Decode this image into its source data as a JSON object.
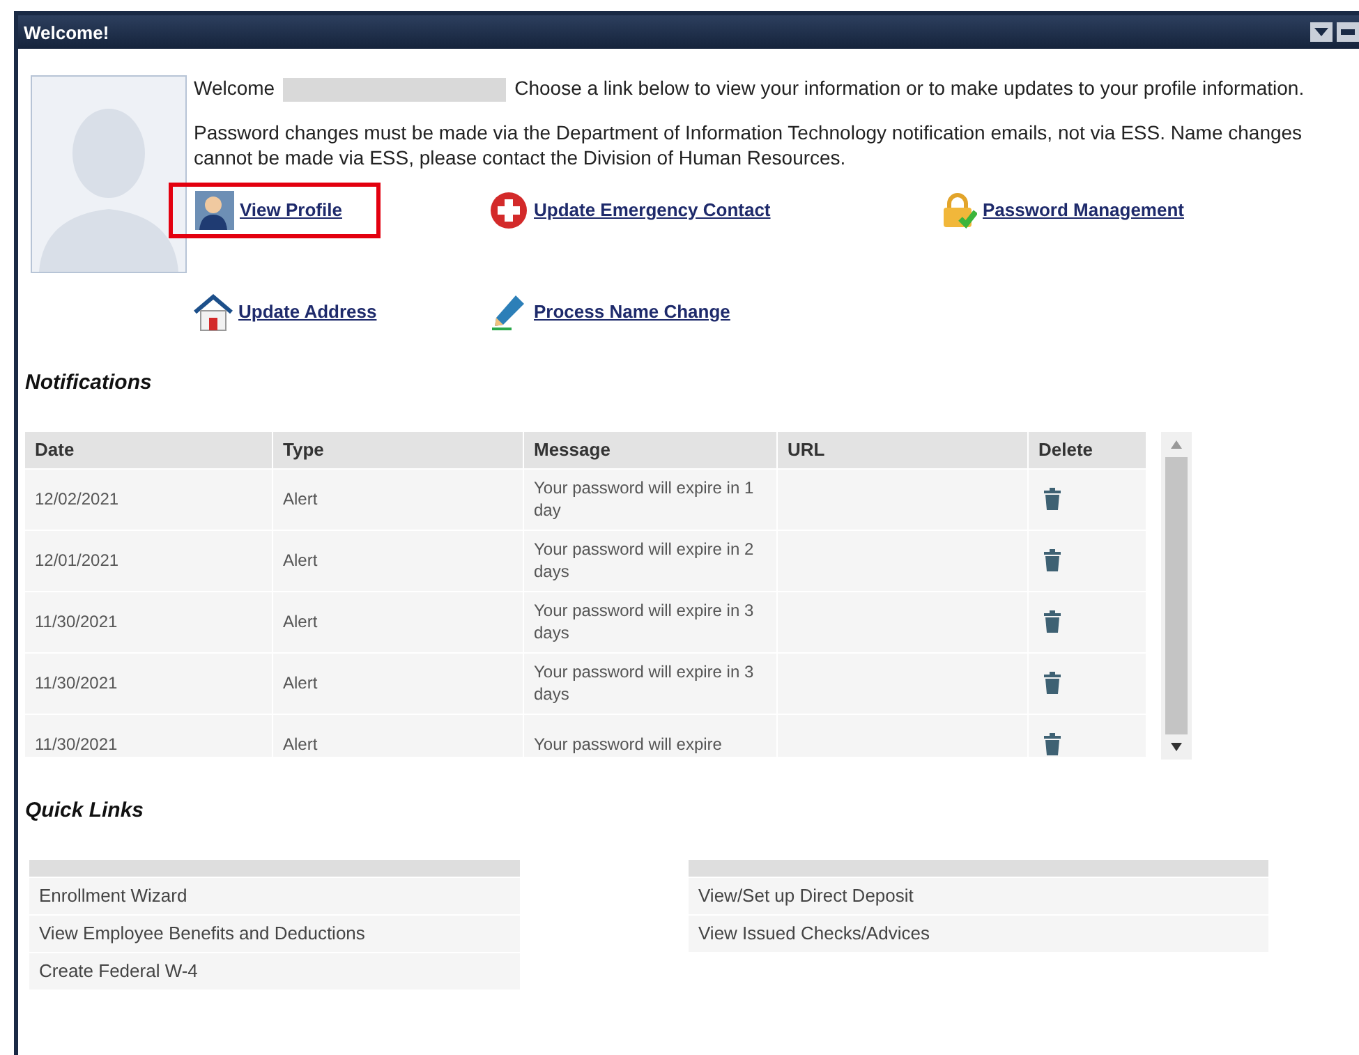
{
  "window": {
    "title": "Welcome!"
  },
  "welcome": {
    "greeting": "Welcome",
    "intro": "Choose a link below to view your information or to make updates to your profile information.",
    "notice": "Password changes must be made via the Department of Information Technology notification emails, not via ESS. Name changes cannot be made via ESS, please contact the Division of Human Resources."
  },
  "links": [
    {
      "label": "View Profile",
      "kind": "person",
      "highlighted": true
    },
    {
      "label": "Update Emergency Contact",
      "kind": "cross",
      "highlighted": false
    },
    {
      "label": "Password Management",
      "kind": "lock",
      "highlighted": false
    },
    {
      "label": "Update Address",
      "kind": "house",
      "highlighted": false
    },
    {
      "label": "Process Name Change",
      "kind": "pencil",
      "highlighted": false
    }
  ],
  "notifications": {
    "title": "Notifications",
    "columns": [
      "Date",
      "Type",
      "Message",
      "URL",
      "Delete"
    ],
    "rows": [
      {
        "date": "12/02/2021",
        "type": "Alert",
        "message": "Your password will expire in 1 day"
      },
      {
        "date": "12/01/2021",
        "type": "Alert",
        "message": "Your password will expire in 2 days"
      },
      {
        "date": "11/30/2021",
        "type": "Alert",
        "message": "Your password will expire in 3 days"
      },
      {
        "date": "11/30/2021",
        "type": "Alert",
        "message": "Your password will expire in 3 days"
      },
      {
        "date": "11/30/2021",
        "type": "Alert",
        "message": "Your password will expire"
      }
    ]
  },
  "quick_links": {
    "title": "Quick Links",
    "left": [
      "Enrollment Wizard",
      "View Employee Benefits and Deductions",
      "Create Federal W-4"
    ],
    "right": [
      "View/Set up Direct Deposit",
      "View Issued Checks/Advices"
    ]
  }
}
